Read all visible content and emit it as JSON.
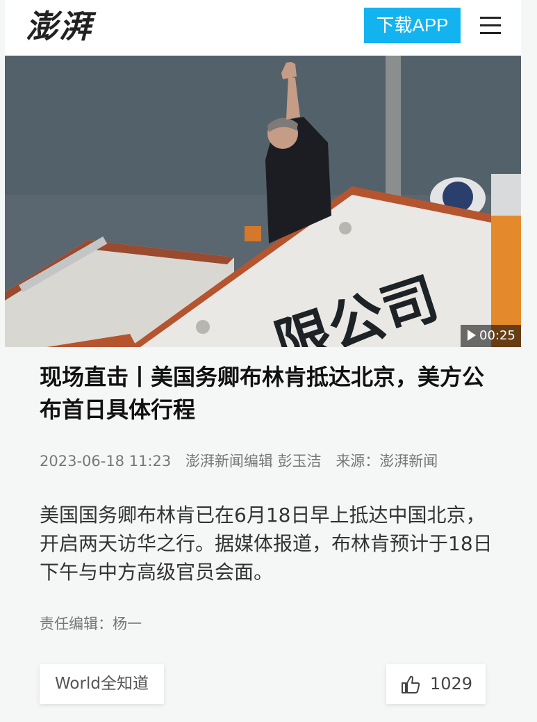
{
  "header": {
    "logo_text": "澎湃",
    "download_label": "下载APP"
  },
  "video": {
    "duration": "00:25",
    "caption_on_image": "限公司"
  },
  "article": {
    "title": "现场直击丨美国务卿布林肯抵达北京，美方公布首日具体行程",
    "datetime": "2023-06-18 11:23",
    "editor_line": "澎湃新闻编辑 彭玉洁",
    "source": "来源：澎湃新闻",
    "summary": "美国国务卿布林肯已在6月18日早上抵达中国北京，开启两天访华之行。据媒体报道，布林肯预计于18日下午与中方高级官员会面。",
    "responsible_editor": "责任编辑：杨一"
  },
  "footer": {
    "tag_label": "World全知道",
    "like_count": "1029"
  }
}
